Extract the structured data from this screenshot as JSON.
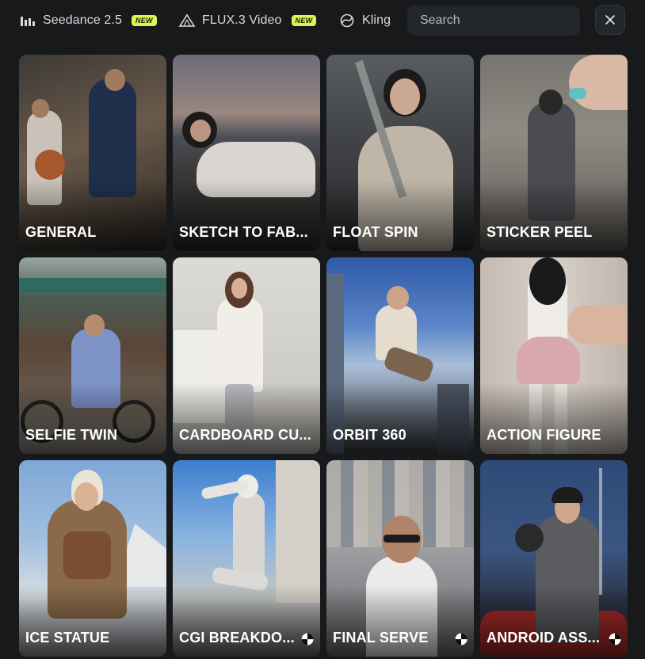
{
  "tabs": [
    {
      "label": "Seedance 2.5",
      "icon": "bars-icon",
      "badge": "NEW"
    },
    {
      "label": "FLUX.3 Video",
      "icon": "triangle-icon",
      "badge": "NEW"
    },
    {
      "label": "Kling",
      "icon": "kling-swirl-icon",
      "badge": ""
    }
  ],
  "search": {
    "placeholder": "Search"
  },
  "close": {
    "icon": "close-icon"
  },
  "cards": [
    {
      "label": "GENERAL",
      "icon": ""
    },
    {
      "label": "SKETCH TO FAB...",
      "icon": ""
    },
    {
      "label": "FLOAT SPIN",
      "icon": ""
    },
    {
      "label": "STICKER PEEL",
      "icon": ""
    },
    {
      "label": "SELFIE TWIN",
      "icon": ""
    },
    {
      "label": "CARDBOARD CU...",
      "icon": ""
    },
    {
      "label": "ORBIT 360",
      "icon": ""
    },
    {
      "label": "ACTION FIGURE",
      "icon": ""
    },
    {
      "label": "ICE STATUE",
      "icon": ""
    },
    {
      "label": "CGI BREAKDO...",
      "icon": "checkered-icon"
    },
    {
      "label": "FINAL SERVE",
      "icon": "checkered-icon"
    },
    {
      "label": "ANDROID ASS...",
      "icon": "checkered-icon"
    }
  ],
  "colors": {
    "background": "#17191b",
    "badge": "#d8f64f",
    "input": "#23262a"
  }
}
